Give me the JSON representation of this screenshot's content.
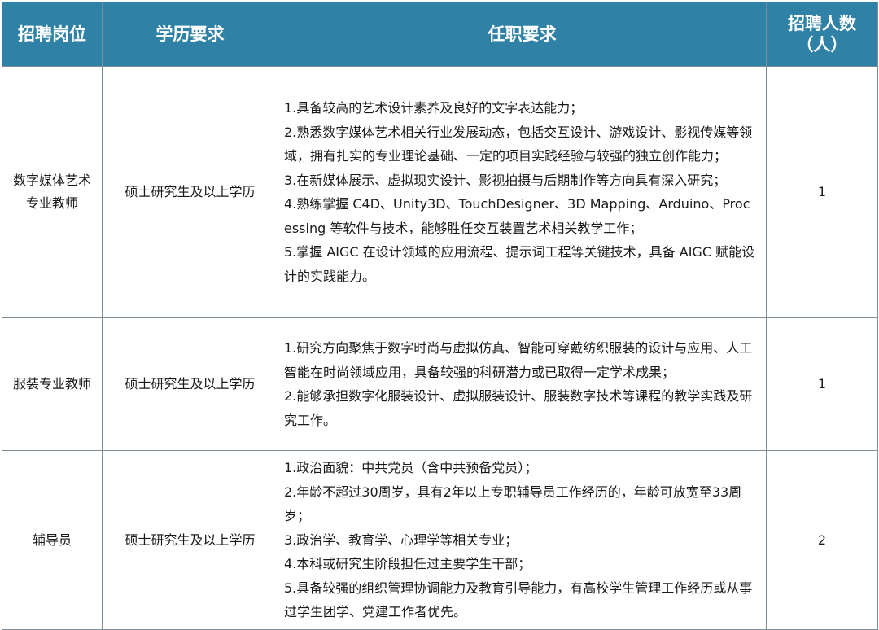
{
  "header": {
    "position": "招聘岗位",
    "education": "学历要求",
    "requirements": "任职要求",
    "headcount_line1": "招聘人数",
    "headcount_line2": "（人）"
  },
  "rows": [
    {
      "position_lines": [
        "数字媒体艺术",
        "专业教师"
      ],
      "education": "硕士研究生及以上学历",
      "requirements": [
        "1.具备较高的艺术设计素养及良好的文字表达能力；",
        "2.熟悉数字媒体艺术相关行业发展动态，包括交互设计、游戏设计、影视传媒等领域，拥有扎实的专业理论基础、一定的项目实践经验与较强的独立创作能力；",
        "3.在新媒体展示、虚拟现实设计、影视拍摄与后期制作等方向具有深入研究；",
        "4.熟练掌握 C4D、Unity3D、TouchDesigner、3D Mapping、Arduino、Processing 等软件与技术，能够胜任交互装置艺术相关教学工作；",
        "5.掌握 AIGC 在设计领域的应用流程、提示词工程等关键技术，具备 AIGC 赋能设计的实践能力。"
      ],
      "headcount": "1"
    },
    {
      "position_lines": [
        "服装专业教师"
      ],
      "education": "硕士研究生及以上学历",
      "requirements": [
        "1.研究方向聚焦于数字时尚与虚拟仿真、智能可穿戴纺织服装的设计与应用、人工智能在时尚领域应用，具备较强的科研潜力或已取得一定学术成果；",
        "2.能够承担数字化服装设计、虚拟服装设计、服装数字技术等课程的教学实践及研究工作。"
      ],
      "headcount": "1"
    },
    {
      "position_lines": [
        "辅导员"
      ],
      "education": "硕士研究生及以上学历",
      "requirements": [
        "1.政治面貌：中共党员（含中共预备党员）；",
        "2.年龄不超过30周岁，具有2年以上专职辅导员工作经历的，年龄可放宽至33周岁；",
        "3.政治学、教育学、心理学等相关专业；",
        "4.本科或研究生阶段担任过主要学生干部；",
        "5.具备较强的组织管理协调能力及教育引导能力，有高校学生管理工作经历或从事过学生团学、党建工作者优先。"
      ],
      "headcount": "2"
    }
  ],
  "colors": {
    "header_bg": "#2f82a6",
    "header_text": "#ffffff",
    "border": "#7f8c99",
    "body_text": "#1a1a1a"
  }
}
